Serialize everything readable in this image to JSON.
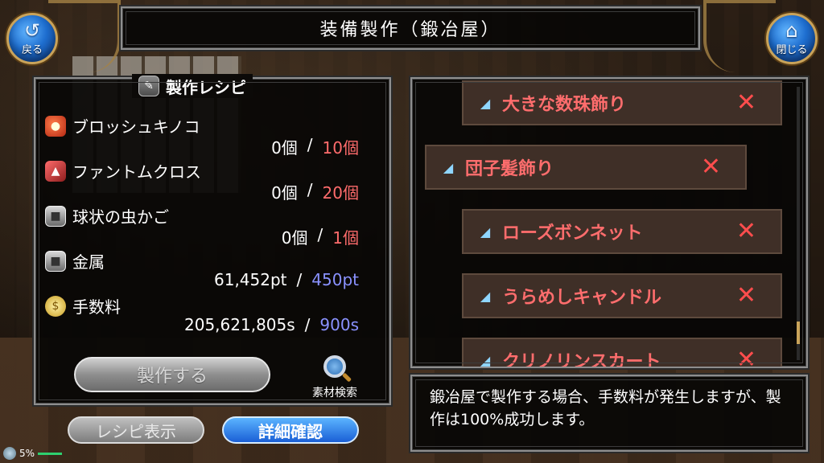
{
  "header": {
    "title": "装備製作（鍛冶屋）",
    "back_label": "戻る",
    "close_label": "閉じる"
  },
  "recipe": {
    "title": "製作レシピ",
    "materials": [
      {
        "name": "ブロッシュキノコ",
        "have": "0個",
        "need": "10個",
        "icon": "mushroom-icon"
      },
      {
        "name": "ファントムクロス",
        "have": "0個",
        "need": "20個",
        "icon": "cloth-icon"
      },
      {
        "name": "球状の虫かご",
        "have": "0個",
        "need": "1個",
        "icon": "box-icon"
      },
      {
        "name": "金属",
        "have": "61,452pt",
        "need": "450pt",
        "icon": "metal-icon"
      },
      {
        "name": "手数料",
        "have": "205,621,805s",
        "need": "900s",
        "icon": "coin-icon"
      }
    ],
    "separator": "/",
    "craft_label": "製作する",
    "search_label": "素材検索",
    "recipe_view_label": "レシピ表示",
    "detail_label": "詳細確認"
  },
  "list": {
    "items": [
      {
        "name": "大きな数珠飾り",
        "mark": "✕"
      },
      {
        "name": "団子髪飾り",
        "mark": "✕"
      },
      {
        "name": "ローズボンネット",
        "mark": "✕"
      },
      {
        "name": "うらめしキャンドル",
        "mark": "✕"
      },
      {
        "name": "クリノリンスカート",
        "mark": "✕"
      }
    ]
  },
  "message": {
    "text": "鍛冶屋で製作する場合、手数料が発生しますが、製作は100%成功します。"
  },
  "status": {
    "percent": "5%"
  },
  "colors": {
    "need_red": "#ff6c6c",
    "need_blue": "#8a92ff",
    "item_name": "#ff6d6d",
    "accent_blue": "#1a5fd6"
  }
}
